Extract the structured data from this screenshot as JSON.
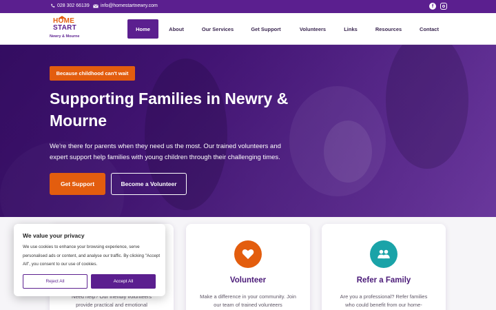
{
  "topbar": {
    "phone": "028 302 66139",
    "email": "info@homestartnewry.com",
    "phone_icon": "phone-icon",
    "email_icon": "envelope-icon",
    "social": [
      "facebook-icon",
      "instagram-icon"
    ]
  },
  "logo": {
    "line1": "HOME",
    "line2": "START",
    "line3": "Newry & Mourne"
  },
  "nav": {
    "items": [
      {
        "label": "Home",
        "active": true
      },
      {
        "label": "About"
      },
      {
        "label": "Our Services"
      },
      {
        "label": "Get Support"
      },
      {
        "label": "Volunteers"
      },
      {
        "label": "Links"
      },
      {
        "label": "Resources"
      },
      {
        "label": "Contact"
      }
    ]
  },
  "hero": {
    "tagline": "Because childhood can't wait",
    "title": "Supporting Families in Newry & Mourne",
    "subtitle": "We're there for parents when they need us the most. Our trained volunteers and expert support help families with young children through their challenging times.",
    "primary_button": "Get Support",
    "secondary_button": "Become a Volunteer"
  },
  "cards": [
    {
      "title": "",
      "text": "Need help? Our friendly volunteers provide practical and emotional",
      "icon": "hands-icon",
      "color": "#5b1f8f"
    },
    {
      "title": "Volunteer",
      "text": "Make a difference in your community. Join our team of trained volunteers",
      "icon": "heart-icon",
      "color": "#e35d0e"
    },
    {
      "title": "Refer a Family",
      "text": "Are you a professional? Refer families who could benefit from our home-",
      "icon": "users-icon",
      "color": "#1aa3a8"
    }
  ],
  "cookie": {
    "title": "We value your privacy",
    "text": "We use cookies to enhance your browsing experience, serve personalised ads or content, and analyse our traffic. By clicking \"Accept All\", you consent to our use of cookies.",
    "reject_label": "Reject All",
    "accept_label": "Accept All"
  },
  "colors": {
    "brand_purple": "#5b1f8f",
    "accent_orange": "#e35d0e",
    "teal": "#1aa3a8"
  }
}
